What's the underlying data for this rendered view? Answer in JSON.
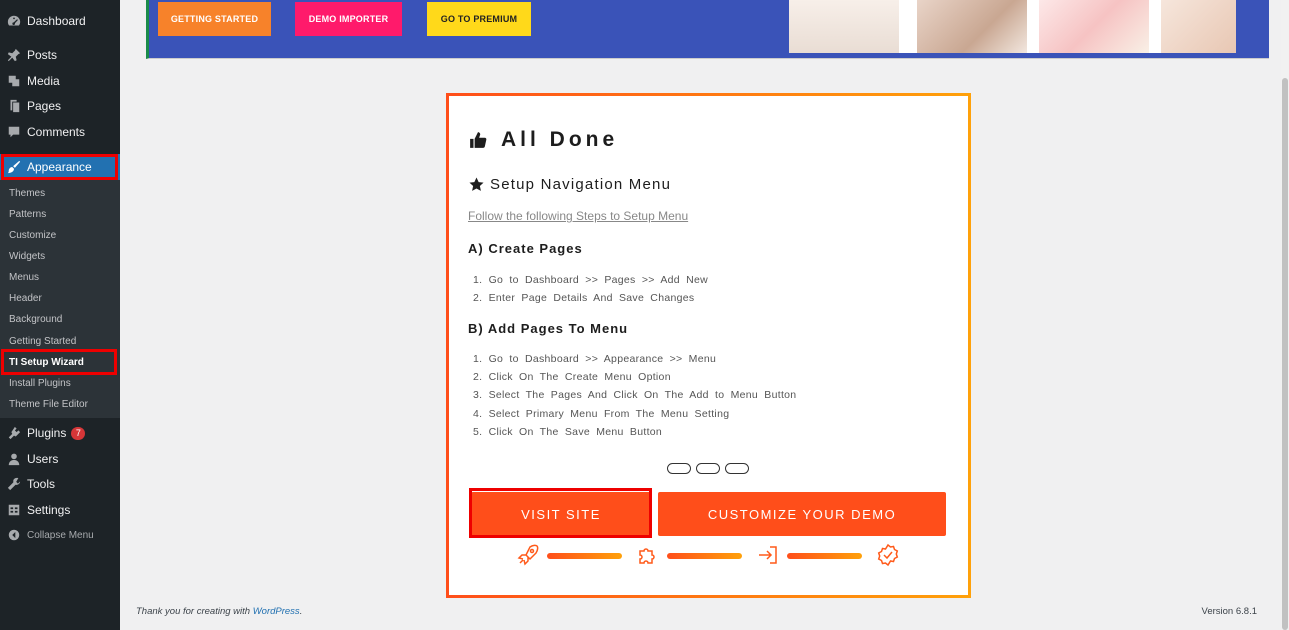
{
  "sidebar": {
    "items": [
      {
        "label": "Dashboard",
        "icon": "dashboard-icon"
      },
      {
        "label": "Posts",
        "icon": "pin-icon"
      },
      {
        "label": "Media",
        "icon": "media-icon"
      },
      {
        "label": "Pages",
        "icon": "pages-icon"
      },
      {
        "label": "Comments",
        "icon": "comment-icon"
      },
      {
        "label": "Appearance",
        "icon": "brush-icon"
      },
      {
        "label": "Plugins",
        "icon": "plugin-icon",
        "badge": "7"
      },
      {
        "label": "Users",
        "icon": "user-icon"
      },
      {
        "label": "Tools",
        "icon": "wrench-icon"
      },
      {
        "label": "Settings",
        "icon": "settings-icon"
      },
      {
        "label": "Collapse Menu",
        "icon": "collapse-icon"
      }
    ],
    "submenu": [
      "Themes",
      "Patterns",
      "Customize",
      "Widgets",
      "Menus",
      "Header",
      "Background",
      "Getting Started",
      "TI Setup Wizard",
      "Install Plugins",
      "Theme File Editor"
    ]
  },
  "banner": {
    "buttons": [
      {
        "label": "GETTING STARTED",
        "color": "#f7822a"
      },
      {
        "label": "DEMO IMPORTER",
        "color": "#ff1a6b"
      },
      {
        "label": "GO TO PREMIUM",
        "color": "#ffd91a"
      }
    ]
  },
  "card": {
    "title": "All Done",
    "subtitle": "Setup Navigation Menu",
    "link": "Follow the following Steps to Setup Menu",
    "section_a": {
      "heading": "A) Create Pages",
      "steps": [
        "1. Go to Dashboard >> Pages >> Add New",
        "2. Enter Page Details And Save Changes"
      ]
    },
    "section_b": {
      "heading": "B) Add Pages To Menu",
      "steps": [
        "1. Go to Dashboard >> Appearance >> Menu",
        "2. Click On The Create Menu Option",
        "3. Select The Pages And Click On The Add to Menu Button",
        "4. Select Primary Menu From The Menu Setting",
        "5. Click On The Save Menu Button"
      ]
    },
    "visit_site": "VISIT SITE",
    "customize_demo": "CUSTOMIZE YOUR DEMO",
    "accent": "#ff4e1a"
  },
  "footer": {
    "thanks": "Thank you for creating with ",
    "wordpress": "WordPress",
    "period": ".",
    "version": "Version 6.8.1"
  }
}
